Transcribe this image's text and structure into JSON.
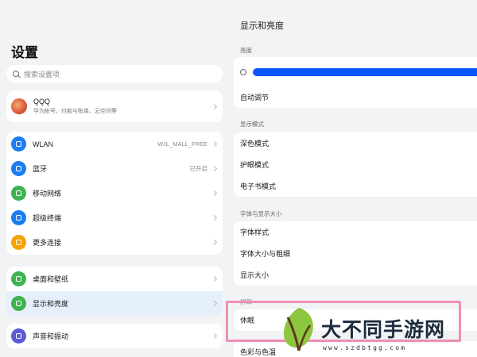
{
  "colors": {
    "accent": "#0a59f7",
    "highlight": "#f08fb3",
    "selected_bg": "#e6f0fd"
  },
  "settings": {
    "title": "设置",
    "search_placeholder": "搜索设置项",
    "account": {
      "name": "QQQ",
      "subtitle": "华为帐号、付款与账单、云空间等",
      "icon": "avatar"
    },
    "groups": [
      [
        {
          "label": "WLAN",
          "value": "WJL_MALL_FREE",
          "icon": "wifi-icon",
          "color": "#1c7cf2"
        },
        {
          "label": "蓝牙",
          "value": "已开启",
          "icon": "bluetooth-icon",
          "color": "#1c7cf2"
        },
        {
          "label": "移动网络",
          "value": "",
          "icon": "mobile-network-icon",
          "color": "#3fb34f"
        },
        {
          "label": "超级终端",
          "value": "",
          "icon": "super-device-icon",
          "color": "#1c7cf2"
        },
        {
          "label": "更多连接",
          "value": "",
          "icon": "more-connections-icon",
          "color": "#f5a300"
        }
      ],
      [
        {
          "label": "桌面和壁纸",
          "value": "",
          "icon": "wallpaper-icon",
          "color": "#3fb34f"
        },
        {
          "label": "显示和亮度",
          "value": "",
          "icon": "display-icon",
          "color": "#3fb34f",
          "selected": true
        }
      ],
      [
        {
          "label": "声音和振动",
          "value": "",
          "icon": "sound-icon",
          "color": "#5b5bd6"
        }
      ]
    ]
  },
  "display": {
    "title": "显示和亮度",
    "brightness": {
      "section": "亮度",
      "level": 1.0,
      "auto_label": "自动调节"
    },
    "mode": {
      "section": "显示模式",
      "items": [
        "深色模式",
        "护眼模式",
        "电子书模式"
      ]
    },
    "font": {
      "section": "字体与显示大小",
      "items": [
        "字体样式",
        "字体大小与粗细",
        "显示大小"
      ]
    },
    "sleep": {
      "section": "屏幕",
      "items": [
        "休眠"
      ]
    },
    "color": {
      "items": [
        "色彩与色温"
      ]
    }
  },
  "watermark": {
    "text": "大不同手游网",
    "url": "www.szdbtgg.com"
  }
}
